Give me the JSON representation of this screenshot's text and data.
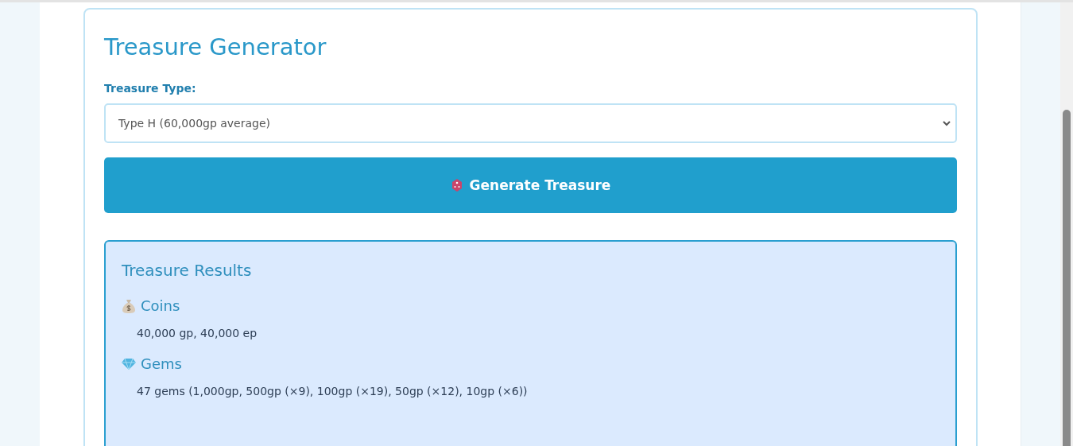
{
  "title": "Treasure Generator",
  "treasure_type": {
    "label": "Treasure Type:",
    "value": "Type H (60,000gp average)"
  },
  "generate_button": {
    "label": "Generate Treasure"
  },
  "results": {
    "title": "Treasure Results",
    "sections": [
      {
        "kind": "coins",
        "heading": "Coins",
        "text": "40,000 gp, 40,000 ep"
      },
      {
        "kind": "gems",
        "heading": "Gems",
        "text": "47 gems (1,000gp, 500gp (×9), 100gp (×19), 50gp (×12), 10gp (×6))"
      }
    ]
  }
}
